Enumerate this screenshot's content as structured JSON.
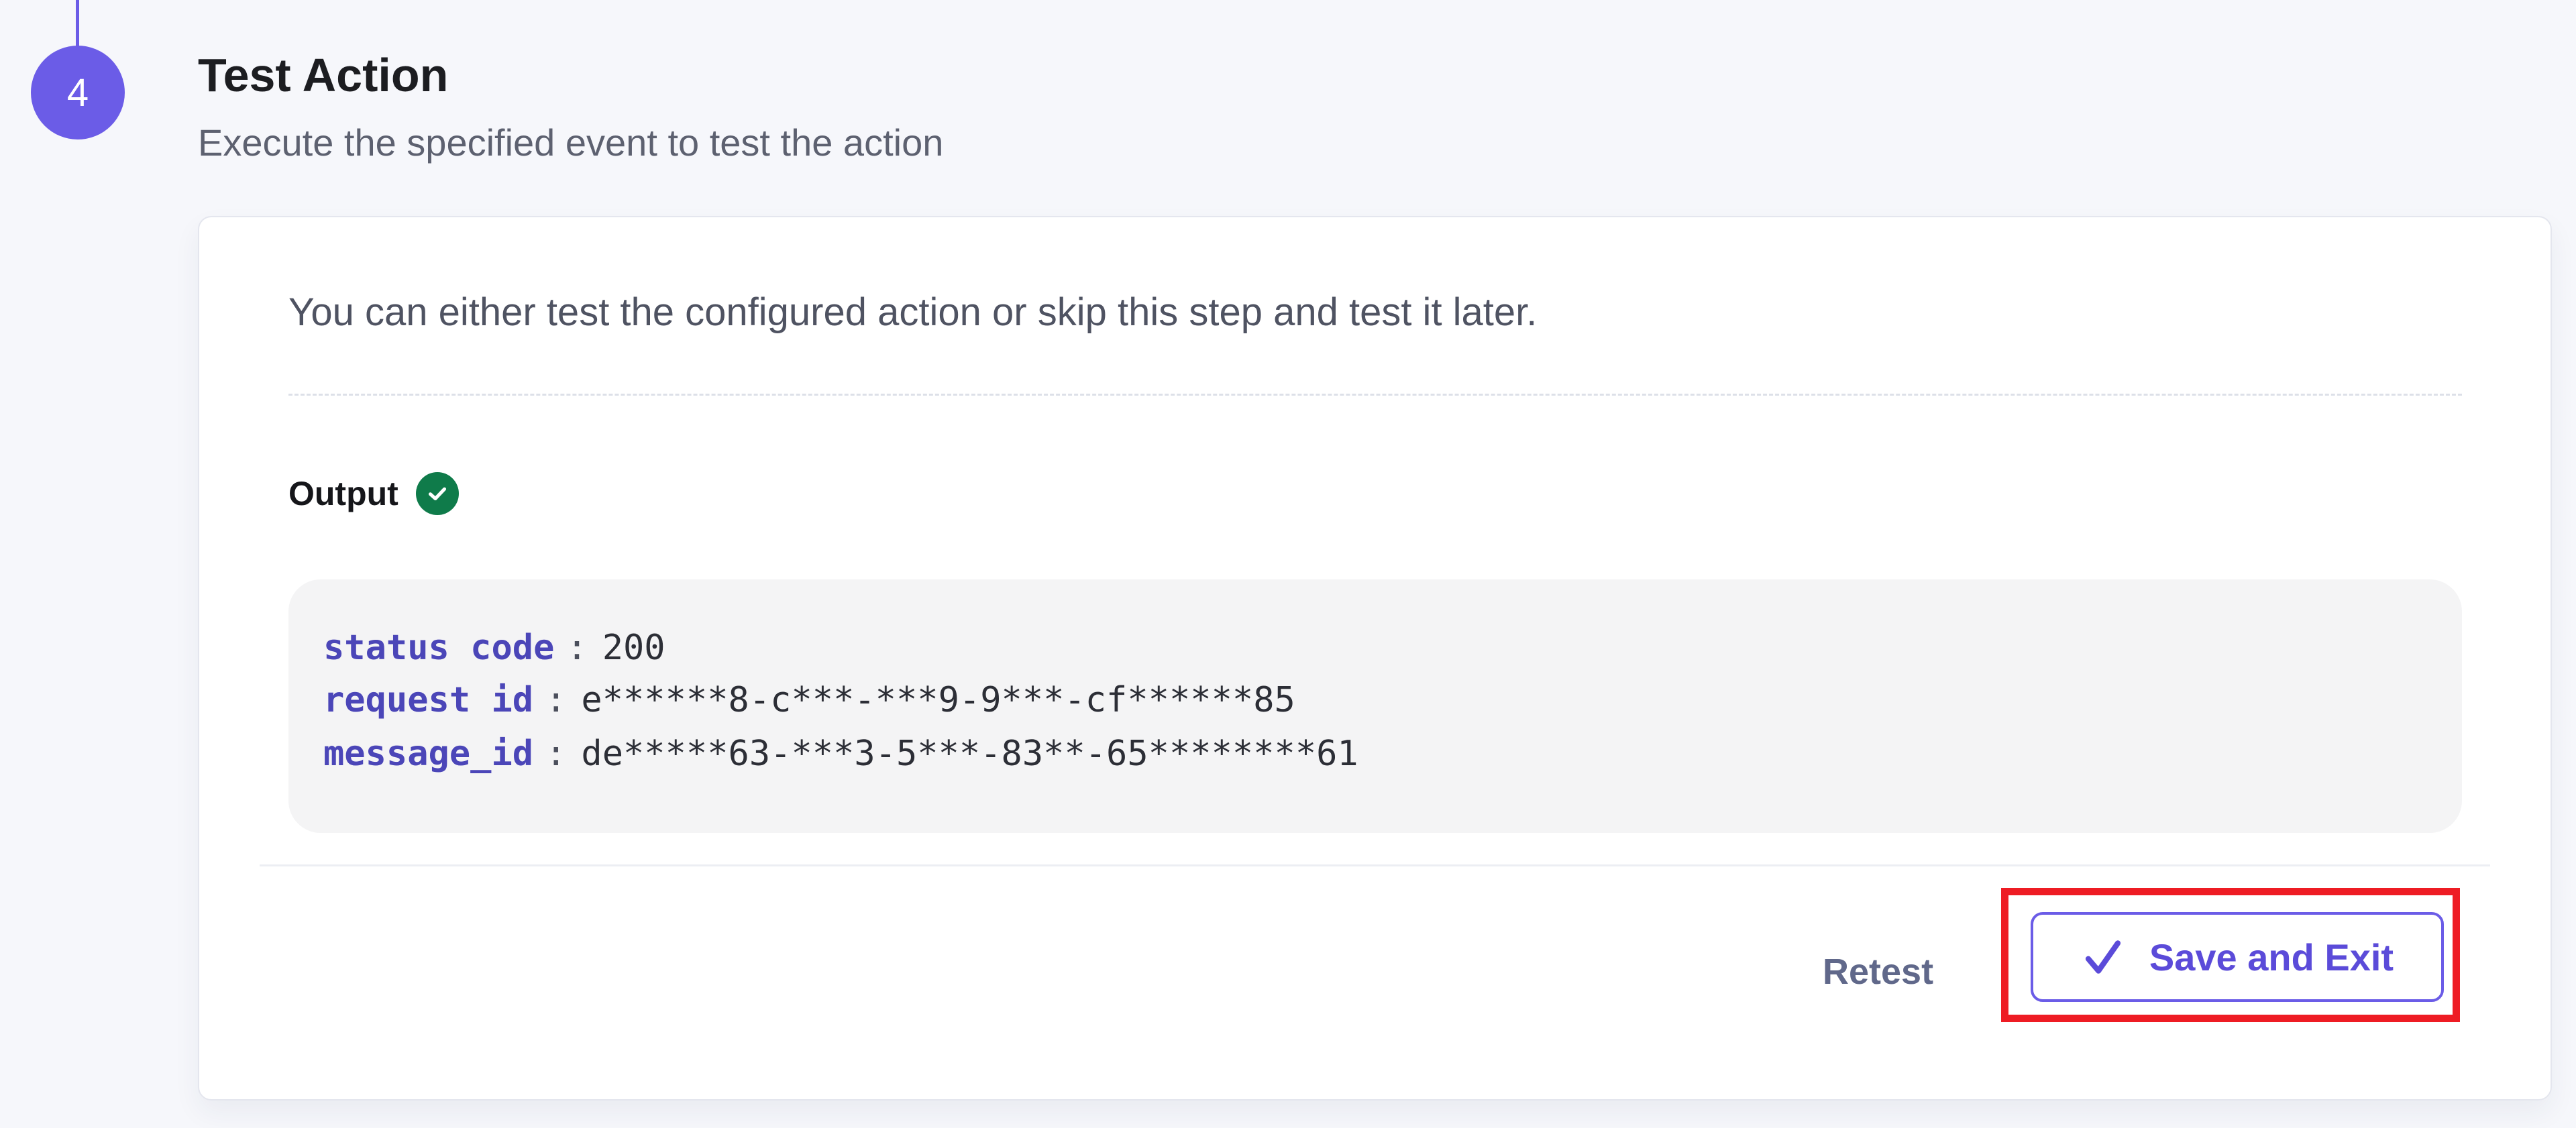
{
  "step": {
    "number": "4",
    "title": "Test Action",
    "subtitle": "Execute the specified event to test the action"
  },
  "card": {
    "intro": "You can either test the configured action or skip this step and test it later.",
    "output_label": "Output",
    "output_status_icon": "check-circle-icon",
    "output": {
      "rows": [
        {
          "key": "status code",
          "value": "200"
        },
        {
          "key": "request id",
          "value": "e******8-c***-***9-9***-cf******85"
        },
        {
          "key": "message_id",
          "value": "de*****63-***3-5***-83**-65********61"
        }
      ]
    },
    "actions": {
      "retest_label": "Retest",
      "save_exit_label": "Save and Exit"
    }
  },
  "colors": {
    "accent": "#6b5ce7",
    "success": "#0f7b4a",
    "highlight": "#ee1c24",
    "key_text": "#4b46b8"
  }
}
